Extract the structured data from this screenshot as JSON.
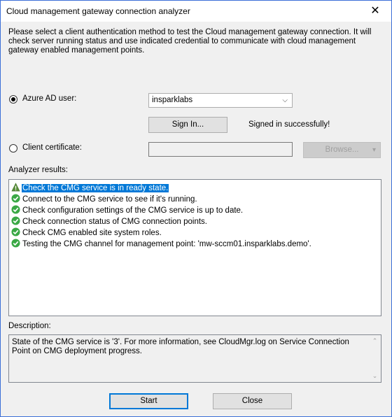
{
  "window": {
    "title": "Cloud management gateway connection analyzer",
    "close_glyph": "✕"
  },
  "intro_text": "Please select a client authentication method to test the Cloud management gateway connection. It will check server running status and use indicated credential to communicate with cloud management gateway enabled management points.",
  "auth": {
    "azure_label": "Azure AD user:",
    "azure_selected": true,
    "azure_dropdown_value": "insparklabs",
    "signin_button": "Sign In...",
    "signin_status": "Signed in successfully!",
    "cert_label": "Client certificate:",
    "cert_selected": false,
    "cert_value": "",
    "browse_button": "Browse..."
  },
  "results": {
    "label": "Analyzer results:",
    "items": [
      {
        "status": "warning",
        "icon": "warning-icon",
        "text": "Check the CMG service is in ready state."
      },
      {
        "status": "success",
        "icon": "success-check-icon",
        "text": "Connect to the CMG service to see if it's running."
      },
      {
        "status": "success",
        "icon": "success-check-icon",
        "text": "Check configuration settings of the CMG service is up to date."
      },
      {
        "status": "success",
        "icon": "success-check-icon",
        "text": "Check connection status of CMG connection points."
      },
      {
        "status": "success",
        "icon": "success-check-icon",
        "text": "Check CMG enabled site system roles."
      },
      {
        "status": "success",
        "icon": "success-check-icon",
        "text": "Testing the CMG channel for management point: 'mw-sccm01.insparklabs.demo'."
      }
    ]
  },
  "description": {
    "label": "Description:",
    "text": "State of the CMG service is '3'. For more information, see CloudMgr.log on Service Connection Point on CMG deployment progress."
  },
  "buttons": {
    "start": "Start",
    "close": "Close"
  },
  "colors": {
    "selection": "#0078d7",
    "success": "#3aa845",
    "warning": "#f0c419",
    "window_border": "#3c6fd8"
  }
}
